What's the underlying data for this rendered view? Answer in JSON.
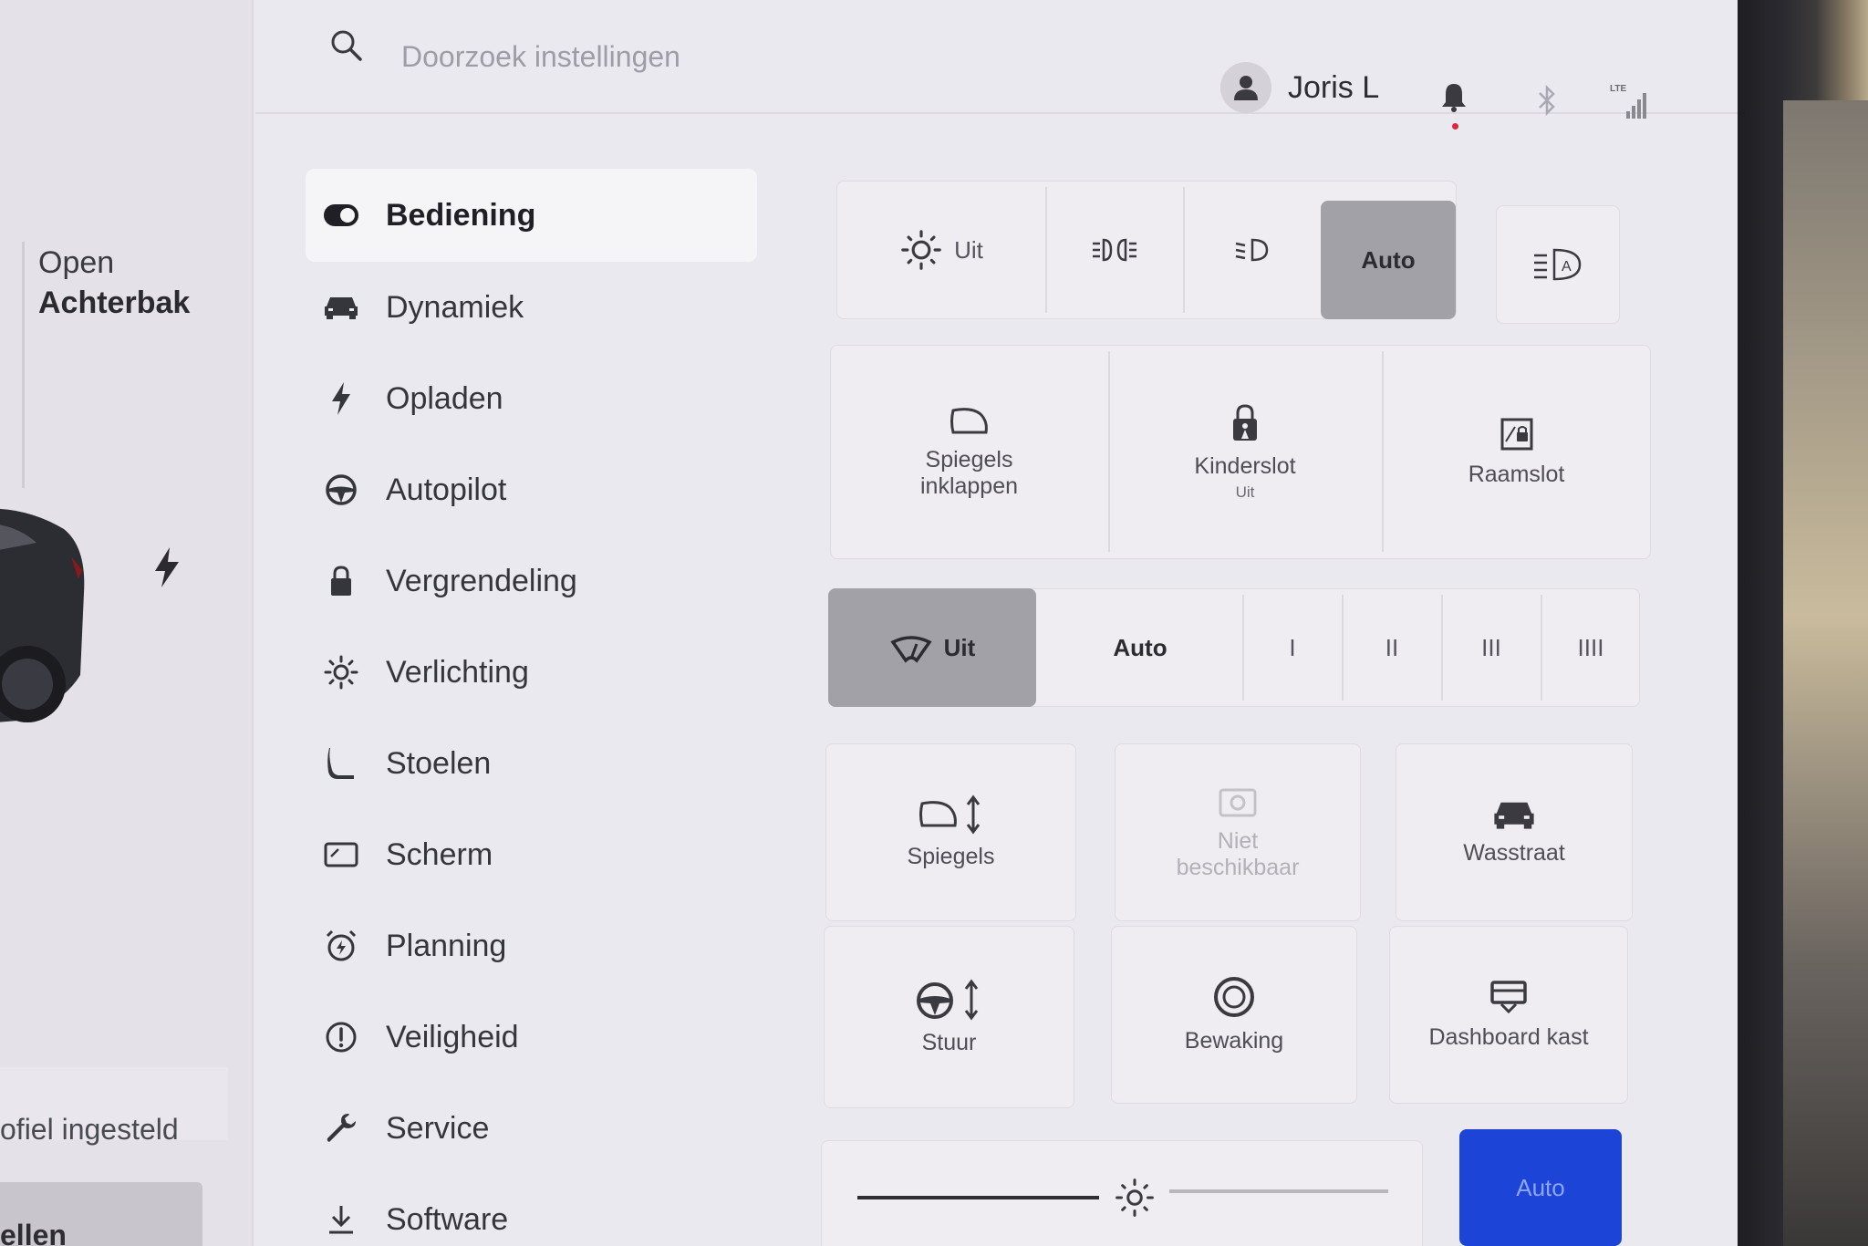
{
  "car_panel": {
    "trunk_line1": "Open",
    "trunk_line2": "Achterbak",
    "profile_status": "ofiel ingesteld",
    "profile_button": "ellen"
  },
  "topbar": {
    "search_placeholder": "Doorzoek instellingen",
    "user_name": "Joris L",
    "network_label": "LTE"
  },
  "nav": {
    "items": [
      {
        "label": "Bediening",
        "icon": "toggle-icon",
        "active": true
      },
      {
        "label": "Dynamiek",
        "icon": "car-icon"
      },
      {
        "label": "Opladen",
        "icon": "bolt-icon"
      },
      {
        "label": "Autopilot",
        "icon": "steering-wheel-icon"
      },
      {
        "label": "Vergrendeling",
        "icon": "lock-icon"
      },
      {
        "label": "Verlichting",
        "icon": "sun-icon"
      },
      {
        "label": "Stoelen",
        "icon": "seat-icon"
      },
      {
        "label": "Scherm",
        "icon": "display-icon"
      },
      {
        "label": "Planning",
        "icon": "alarm-clock-icon"
      },
      {
        "label": "Veiligheid",
        "icon": "alert-circle-icon"
      },
      {
        "label": "Service",
        "icon": "wrench-icon"
      },
      {
        "label": "Software",
        "icon": "download-icon"
      }
    ]
  },
  "lights": {
    "off_label": "Uit",
    "auto_label": "Auto",
    "selected": "Auto"
  },
  "tiles_row1": {
    "mirrors_fold_l1": "Spiegels",
    "mirrors_fold_l2": "inklappen",
    "child_lock": "Kinderslot",
    "child_lock_state": "Uit",
    "window_lock": "Raamslot"
  },
  "wipers": {
    "off_label": "Uit",
    "auto_label": "Auto",
    "speeds": [
      "I",
      "II",
      "III",
      "IIII"
    ],
    "selected": "Uit"
  },
  "tiles_grid": {
    "mirrors": "Spiegels",
    "unavailable_l1": "Niet",
    "unavailable_l2": "beschikbaar",
    "car_wash": "Wasstraat",
    "steering": "Stuur",
    "sentry": "Bewaking",
    "glovebox": "Dashboard kast"
  },
  "brightness": {
    "auto_label": "Auto",
    "level": 0.47
  },
  "colors": {
    "accent_blue": "#1c44d6",
    "selected_grey": "#a3a1a8",
    "notification_red": "#e0273a"
  }
}
